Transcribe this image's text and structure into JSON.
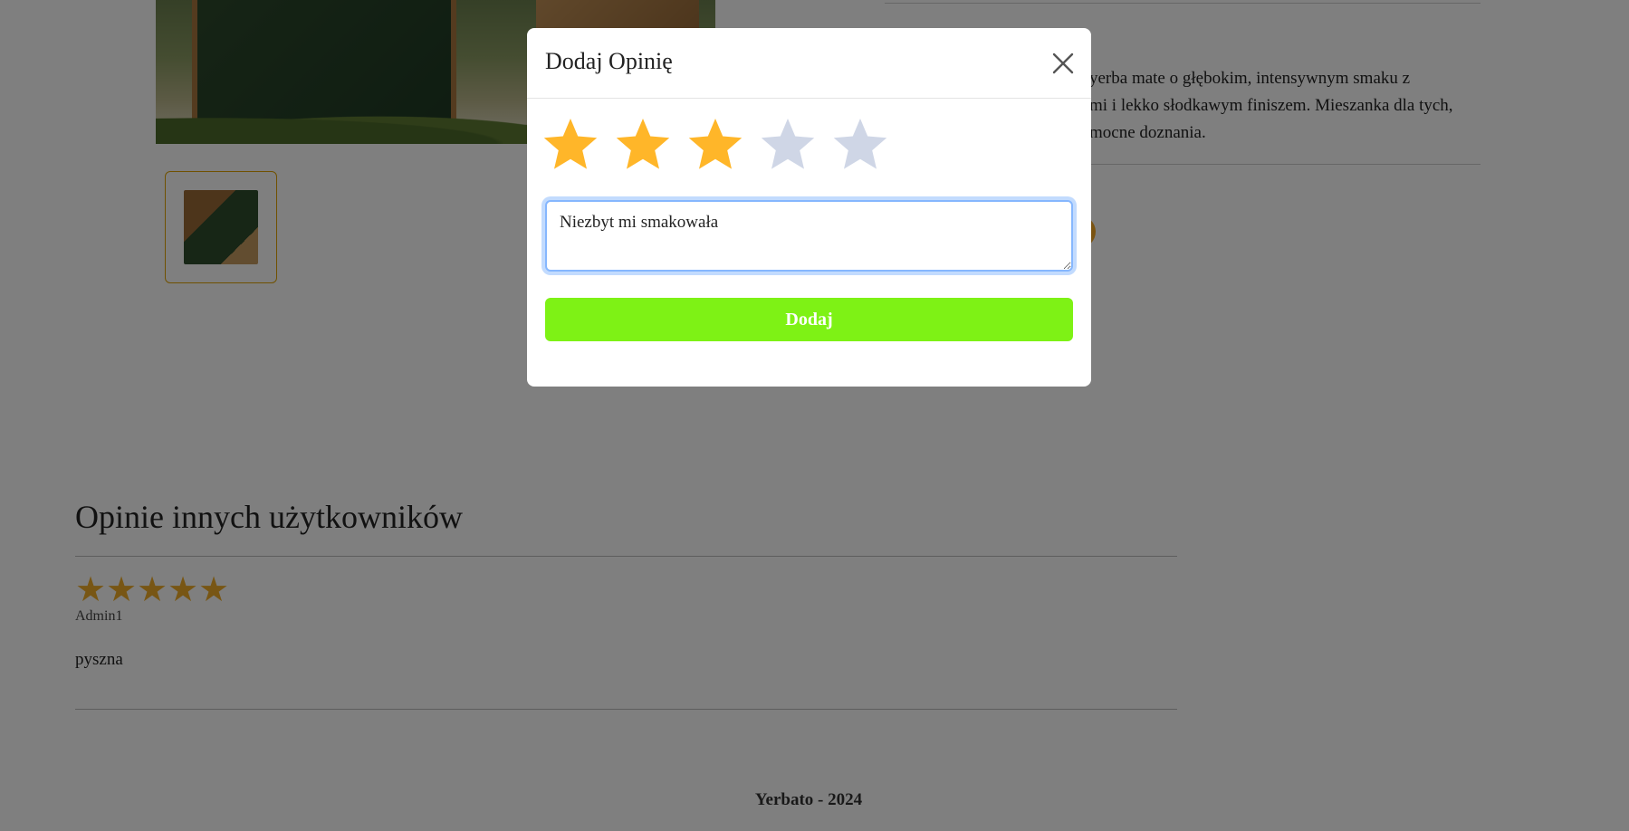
{
  "product": {
    "description_lines": [
      "yerba mate o głębokim, intensywnym smaku z",
      "mi i lekko słodkawym finiszem. Mieszanka dla tych,",
      "mocne doznania."
    ]
  },
  "reviews": {
    "title": "Opinie innych użytkowników",
    "items": [
      {
        "rating": 5,
        "stars": "★★★★★",
        "author": "Admin1",
        "text": "pyszna"
      }
    ]
  },
  "footer": {
    "text": "Yerbato - 2024"
  },
  "modal": {
    "title": "Dodaj Opinię",
    "rating": 3,
    "max_rating": 5,
    "textarea_value": "Niezbyt mi smakowała",
    "submit_label": "Dodaj"
  },
  "colors": {
    "star_active": "#ffb629",
    "star_inactive": "#cfd6e6",
    "submit_button": "#7ef215",
    "review_star": "#f0ad28"
  },
  "icons": {
    "close": "close-icon",
    "star": "star-icon"
  }
}
